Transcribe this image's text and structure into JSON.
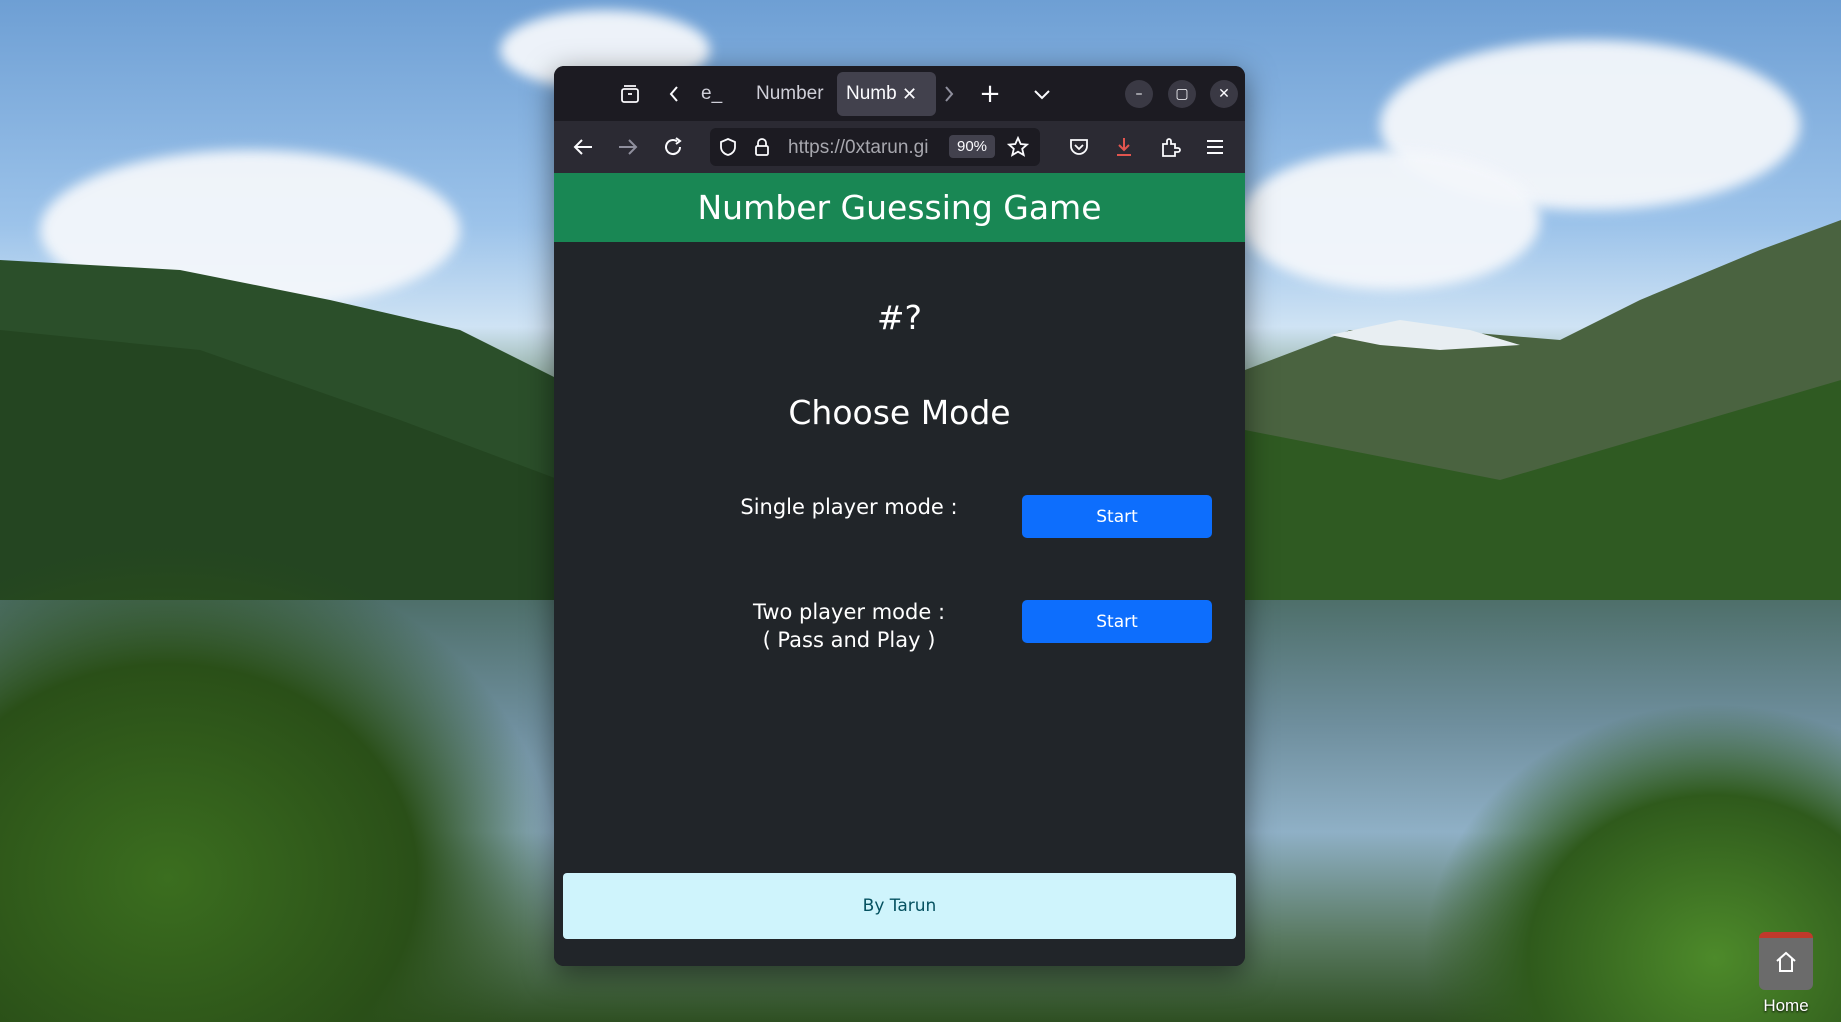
{
  "desktop": {
    "home_label": "Home"
  },
  "browser": {
    "tabs": [
      {
        "label": "e_",
        "active": false
      },
      {
        "label": "Number",
        "active": false
      },
      {
        "label": "Numb",
        "active": true
      }
    ],
    "url": "https://0xtarun.gi",
    "zoom": "90%"
  },
  "app": {
    "title": "Number Guessing Game",
    "mystery": "#?",
    "choose_heading": "Choose Mode",
    "modes": [
      {
        "label_line1": "Single player mode :",
        "label_line2": "",
        "button": "Start"
      },
      {
        "label_line1": "Two player mode :",
        "label_line2": "( Pass and Play )",
        "button": "Start"
      }
    ],
    "footer": "By Tarun"
  },
  "colors": {
    "header_green": "#198754",
    "button_blue": "#0d6efd",
    "footer_bg": "#cff4fc",
    "page_bg": "#212529"
  }
}
